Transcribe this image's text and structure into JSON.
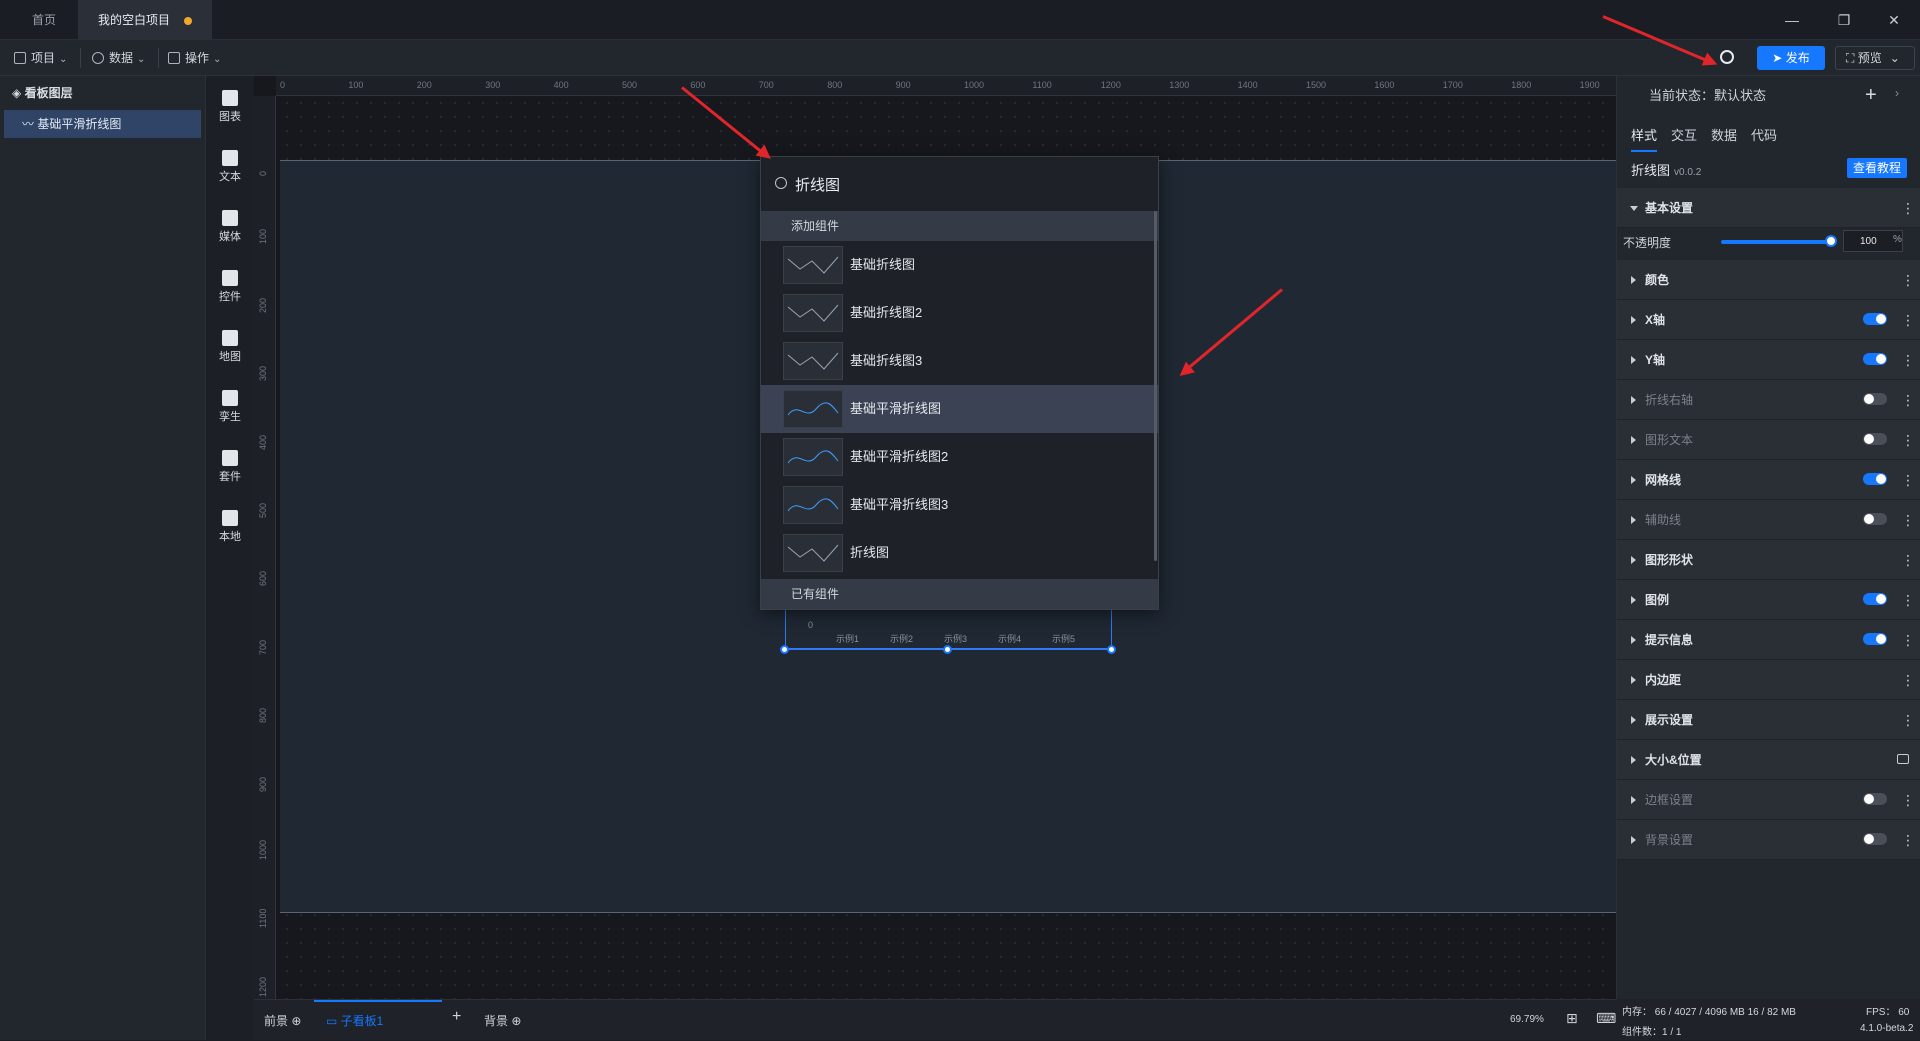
{
  "titlebar": {
    "tabs": [
      {
        "label": "首页",
        "active": false
      },
      {
        "label": "我的空白项目",
        "active": true,
        "unsaved": true
      }
    ]
  },
  "toolbar": {
    "menus": [
      "项目",
      "数据",
      "操作"
    ],
    "publish_label": "发布",
    "preview_label": "预览"
  },
  "layers": {
    "header": "看板图层",
    "items": [
      "基础平滑折线图"
    ]
  },
  "component_bar": {
    "items": [
      {
        "label": "图表",
        "icon": "bar-chart-icon"
      },
      {
        "label": "文本",
        "icon": "text-icon"
      },
      {
        "label": "媒体",
        "icon": "media-icon"
      },
      {
        "label": "控件",
        "icon": "control-icon"
      },
      {
        "label": "地图",
        "icon": "map-icon"
      },
      {
        "label": "孪生",
        "icon": "cube-icon"
      },
      {
        "label": "套件",
        "icon": "kit-icon"
      },
      {
        "label": "本地",
        "icon": "puzzle-icon"
      }
    ]
  },
  "ruler": {
    "top_ticks": [
      "0",
      "100",
      "200",
      "300",
      "400",
      "500",
      "600",
      "700",
      "800",
      "900",
      "1000",
      "1100",
      "1200",
      "1300",
      "1400",
      "1500",
      "1600",
      "1700",
      "1800",
      "1900"
    ],
    "left_ticks": [
      "0",
      "100",
      "200",
      "300",
      "400",
      "500",
      "600",
      "700",
      "800",
      "900",
      "1000",
      "1100",
      "1200"
    ]
  },
  "chart_axis": {
    "y_zero": "0",
    "x_labels": [
      "示例1",
      "示例2",
      "示例3",
      "示例4",
      "示例5"
    ]
  },
  "search": {
    "query": "折线图",
    "group_add": "添加组件",
    "group_existing": "已有组件",
    "results": [
      {
        "label": "基础折线图",
        "highlighted": false
      },
      {
        "label": "基础折线图2",
        "highlighted": false
      },
      {
        "label": "基础折线图3",
        "highlighted": false
      },
      {
        "label": "基础平滑折线图",
        "highlighted": true
      },
      {
        "label": "基础平滑折线图2",
        "highlighted": false
      },
      {
        "label": "基础平滑折线图3",
        "highlighted": false
      },
      {
        "label": "折线图",
        "highlighted": false
      }
    ]
  },
  "right_panel": {
    "state_label": "当前状态：默认状态",
    "tabs": [
      "样式",
      "交互",
      "数据",
      "代码"
    ],
    "component_name": "折线图",
    "component_version": "v0.0.2",
    "tutorial_label": "查看教程",
    "opacity_label": "不透明度",
    "opacity_value": "100",
    "opacity_unit": "%",
    "opacity": 1.0,
    "sections": [
      {
        "label": "基本设置",
        "state": "open",
        "control": "more"
      },
      {
        "label": "颜色",
        "state": "normal",
        "control": "more"
      },
      {
        "label": "X轴",
        "state": "normal",
        "control": "toggle-on"
      },
      {
        "label": "Y轴",
        "state": "normal",
        "control": "toggle-on"
      },
      {
        "label": "折线右轴",
        "state": "disabled",
        "control": "toggle-off"
      },
      {
        "label": "图形文本",
        "state": "disabled",
        "control": "toggle-off"
      },
      {
        "label": "网格线",
        "state": "normal",
        "control": "toggle-on"
      },
      {
        "label": "辅助线",
        "state": "disabled",
        "control": "toggle-off"
      },
      {
        "label": "图形形状",
        "state": "normal",
        "control": "more"
      },
      {
        "label": "图例",
        "state": "normal",
        "control": "toggle-on"
      },
      {
        "label": "提示信息",
        "state": "normal",
        "control": "toggle-on"
      },
      {
        "label": "内边距",
        "state": "normal",
        "control": "more"
      },
      {
        "label": "展示设置",
        "state": "normal",
        "control": "more"
      },
      {
        "label": "大小&位置",
        "state": "normal",
        "control": "lock"
      },
      {
        "label": "边框设置",
        "state": "disabled",
        "control": "toggle-off"
      },
      {
        "label": "背景设置",
        "state": "disabled",
        "control": "toggle-off"
      }
    ]
  },
  "bottom_bar": {
    "foreground": "前景",
    "sub_board": "子看板1",
    "background": "背景",
    "zoom": "69.79%"
  },
  "status": {
    "memory": "内存： 66 / 4027 / 4096 MB  16 / 82 MB",
    "fps": "FPS： 60",
    "components": "组件数：1 / 1",
    "version": "4.1.0-beta.2"
  },
  "colors": {
    "accent": "#1677ff",
    "annotation_arrow": "#e0262b",
    "unsaved_dot": "#f0a92e"
  }
}
